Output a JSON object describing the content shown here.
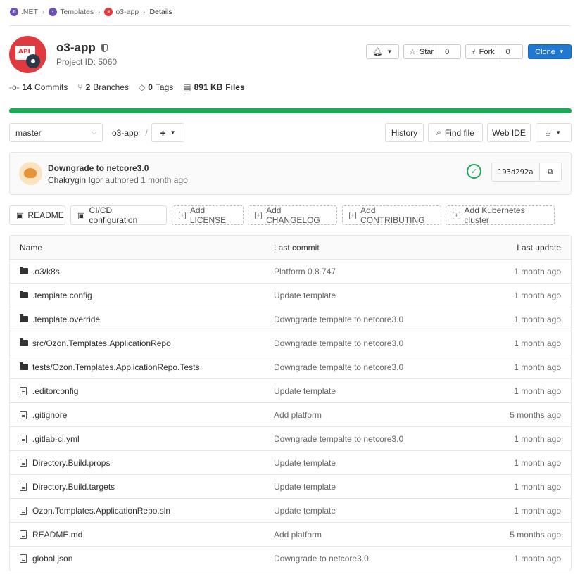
{
  "breadcrumb": [
    {
      "label": ".NET",
      "color": "#6b4fbb",
      "icon": "net-group-icon"
    },
    {
      "label": "Templates",
      "color": "#6b4fbb",
      "icon": "templates-group-icon"
    },
    {
      "label": "o3-app",
      "color": "#e0393e",
      "icon": "project-icon"
    },
    {
      "label": "Details"
    }
  ],
  "project": {
    "name": "o3-app",
    "id_text": "Project ID: 5060",
    "avatar_text": "API"
  },
  "actions": {
    "star_label": "Star",
    "star_count": "0",
    "fork_label": "Fork",
    "fork_count": "0",
    "clone_label": "Clone"
  },
  "stats": [
    {
      "value": "14",
      "label": "Commits",
      "icon": "commit-icon"
    },
    {
      "value": "2",
      "label": "Branches",
      "icon": "branch-icon"
    },
    {
      "value": "0",
      "label": "Tags",
      "icon": "tag-icon"
    },
    {
      "value": "891 KB",
      "label": "Files",
      "icon": "file-size-icon"
    }
  ],
  "language_bar": {
    "color": "#1aaa55",
    "fraction": 1.0
  },
  "toolbar": {
    "branch": "master",
    "path": "o3-app",
    "path_sep": "/",
    "add_symbol": "+",
    "history": "History",
    "find_file": "Find file",
    "web_ide": "Web IDE"
  },
  "last_commit": {
    "message": "Downgrade to netcore3.0",
    "author": "Chakrygin Igor",
    "meta": "authored 1 month ago",
    "sha": "193d292a",
    "status": "passed"
  },
  "chips": [
    {
      "label": "README",
      "style": "solid",
      "icon": "readme-icon"
    },
    {
      "label": "CI/CD configuration",
      "style": "solid",
      "icon": "cicd-icon"
    },
    {
      "label": "Add LICENSE",
      "style": "dashed",
      "icon": "plus-square-icon"
    },
    {
      "label": "Add CHANGELOG",
      "style": "dashed",
      "icon": "plus-square-icon"
    },
    {
      "label": "Add CONTRIBUTING",
      "style": "dashed",
      "icon": "plus-square-icon"
    },
    {
      "label": "Add Kubernetes cluster",
      "style": "dashed",
      "icon": "plus-square-icon"
    }
  ],
  "table": {
    "headers": {
      "name": "Name",
      "commit": "Last commit",
      "update": "Last update"
    },
    "rows": [
      {
        "type": "folder",
        "name": ".o3/k8s",
        "commit": "Platform 0.8.747",
        "update": "1 month ago"
      },
      {
        "type": "folder",
        "name": ".template.config",
        "commit": "Update template",
        "update": "1 month ago"
      },
      {
        "type": "folder",
        "name": ".template.override",
        "commit": "Downgrade tempalte to netcore3.0",
        "update": "1 month ago"
      },
      {
        "type": "folder",
        "name": "src/Ozon.Templates.ApplicationRepo",
        "commit": "Downgrade tempalte to netcore3.0",
        "update": "1 month ago"
      },
      {
        "type": "folder",
        "name": "tests/Ozon.Templates.ApplicationRepo.Tests",
        "commit": "Downgrade tempalte to netcore3.0",
        "update": "1 month ago"
      },
      {
        "type": "file",
        "name": ".editorconfig",
        "commit": "Update template",
        "update": "1 month ago"
      },
      {
        "type": "file",
        "name": ".gitignore",
        "commit": "Add platform",
        "update": "5 months ago"
      },
      {
        "type": "file",
        "name": ".gitlab-ci.yml",
        "commit": "Downgrade tempalte to netcore3.0",
        "update": "1 month ago"
      },
      {
        "type": "file",
        "name": "Directory.Build.props",
        "commit": "Update template",
        "update": "1 month ago"
      },
      {
        "type": "file",
        "name": "Directory.Build.targets",
        "commit": "Update template",
        "update": "1 month ago"
      },
      {
        "type": "file",
        "name": "Ozon.Templates.ApplicationRepo.sln",
        "commit": "Update template",
        "update": "1 month ago"
      },
      {
        "type": "file",
        "name": "README.md",
        "commit": "Add platform",
        "update": "5 months ago"
      },
      {
        "type": "file",
        "name": "global.json",
        "commit": "Downgrade to netcore3.0",
        "update": "1 month ago"
      }
    ]
  }
}
